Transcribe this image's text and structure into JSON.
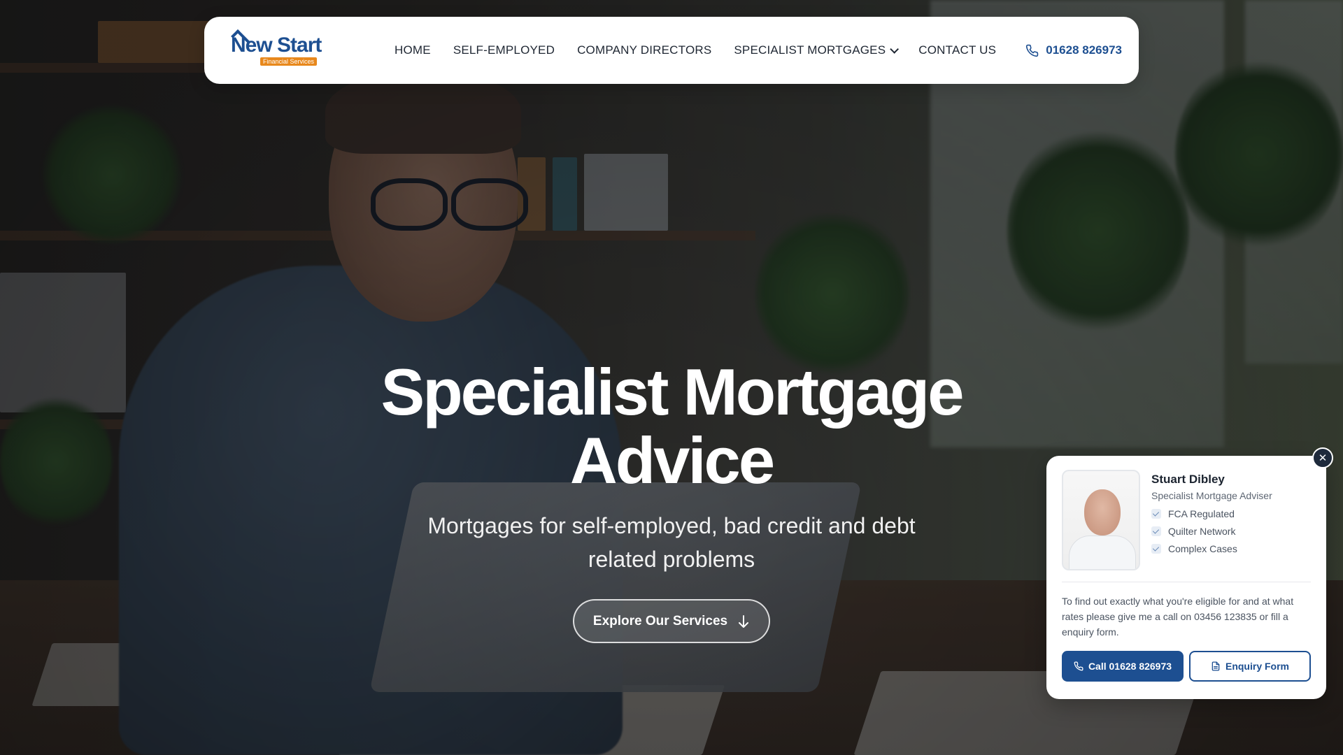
{
  "brand": {
    "logo_name": "New Start",
    "logo_tagline": "Financial Services",
    "primary_color": "#1d4f91",
    "accent_color": "#e8881c"
  },
  "nav": {
    "items": [
      {
        "label": "HOME"
      },
      {
        "label": "SELF-EMPLOYED"
      },
      {
        "label": "COMPANY DIRECTORS"
      },
      {
        "label": "SPECIALIST MORTGAGES",
        "has_dropdown": true
      },
      {
        "label": "CONTACT US"
      }
    ],
    "phone": "01628 826973",
    "phone_icon": "phone-icon"
  },
  "hero": {
    "title_line1": "Specialist Mortgage",
    "title_line2": "Advice",
    "subtitle_line1": "Mortgages for self-employed, bad credit and debt",
    "subtitle_line2": "related problems",
    "cta_label": "Explore Our Services",
    "cta_icon": "arrow-down-icon"
  },
  "adviser_card": {
    "close_label": "✕",
    "name": "Stuart Dibley",
    "role": "Specialist Mortgage Adviser",
    "credentials": [
      "FCA Regulated",
      "Quilter Network",
      "Complex Cases"
    ],
    "message": "To find out exactly what you're eligible for and at what rates please give me a call on 03456 123835 or fill a enquiry form.",
    "call_label": "Call 01628 826973",
    "form_label": "Enquiry Form"
  }
}
